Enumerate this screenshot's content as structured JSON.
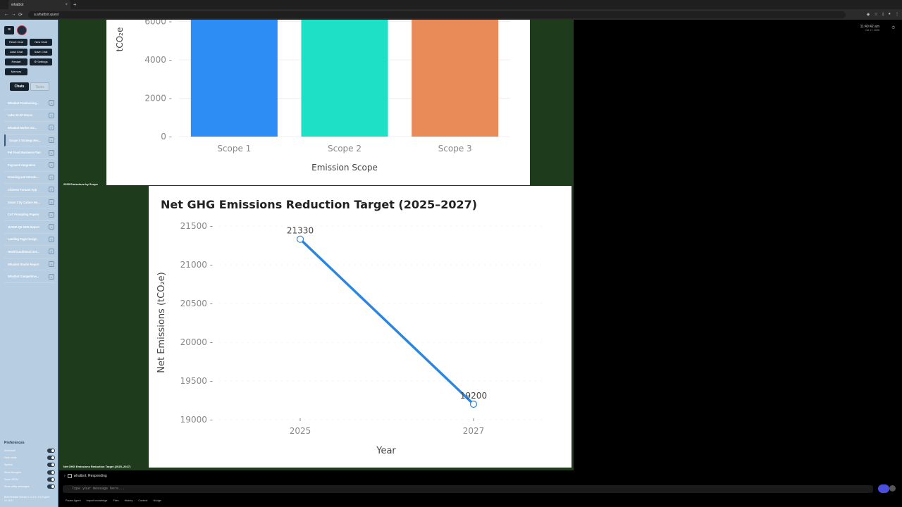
{
  "browser": {
    "tab_title": "whatbot",
    "tab_close": "×",
    "new_tab": "+",
    "url": "a.whatbot.quest",
    "nav": {
      "back": "←",
      "forward": "→",
      "reload": "⟳"
    }
  },
  "sidebar": {
    "menu_icon": "hamburger-icon",
    "buttons": [
      "Reset Chat",
      "New Chat",
      "Load Chat",
      "Save Chat",
      "Restart",
      "⚙ Settings",
      "Memory"
    ],
    "tabs": {
      "active": "Chats",
      "inactive": "Tasks"
    },
    "chats": [
      "Whatbot Fundraising...",
      "Lube 10-20 Stores",
      "Whatbot Market Siz...",
      "Scope 3 Strategy Rec...",
      "Pet Food Business Plan",
      "Payment integration",
      "Greeting and introdu...",
      "Chinese Fortune App",
      "Smart City Carbon Re...",
      "CoT Prompting Papers",
      "NVIDIA Q2 2025 Report",
      "Landing Page Design",
      "Heatil Dashboard Set...",
      "Whatbot Studio Report",
      "Whatbot Competitive..."
    ],
    "active_chat_index": 3,
    "close_glyph": "×",
    "preferences_title": "Preferences",
    "preferences": [
      "Autoscroll",
      "Dark mode",
      "Speech",
      "Show thoughts",
      "Show JSON",
      "Show utility messages"
    ],
    "version": "Built Release Version 0.10.0 v1.0.0-9-g0e0 12:14:57"
  },
  "main": {
    "bar_caption": "2025 Emissions by Scope",
    "line_caption": "Net GHG Emissions Reduction Target (2025–2027)"
  },
  "chart_data": [
    {
      "type": "bar",
      "title": "2025 Emissions by Scope",
      "categories": [
        "Scope 1",
        "Scope 2",
        "Scope 3"
      ],
      "colors": [
        "#2e8cf5",
        "#1ee0c6",
        "#e88b58"
      ],
      "visible_tick_labels": [
        "0",
        "2000",
        "4000",
        "6000"
      ],
      "values_note_min": 6000,
      "ylim_visible": [
        0,
        6000
      ],
      "xlabel": "Emission Scope",
      "ylabel": "tCO₂e",
      "values": [
        6000,
        6000,
        6000
      ],
      "grid": true
    },
    {
      "type": "line",
      "title": "Net GHG Emissions Reduction Target (2025–2027)",
      "x": [
        2025,
        2027
      ],
      "y": [
        21330,
        19200
      ],
      "data_labels": [
        "21330",
        "19200"
      ],
      "xlabel": "Year",
      "ylabel": "Net Emissions (tCO₂e)",
      "yticks": [
        "19000",
        "19500",
        "20000",
        "20500",
        "21000",
        "21500"
      ],
      "xticks": [
        "2025",
        "2027"
      ],
      "ylim": [
        19000,
        21500
      ],
      "color": "#2a86e0",
      "grid": true
    }
  ],
  "status": {
    "time": "11:40:42 am",
    "date": "Oct 17, 2025",
    "responding_label": "whatbot: Responding"
  },
  "input": {
    "placeholder": "Type your message here..."
  },
  "footer": [
    "Pause Agent",
    "Import knowledge",
    "Files",
    "History",
    "Context",
    "Nudge"
  ]
}
